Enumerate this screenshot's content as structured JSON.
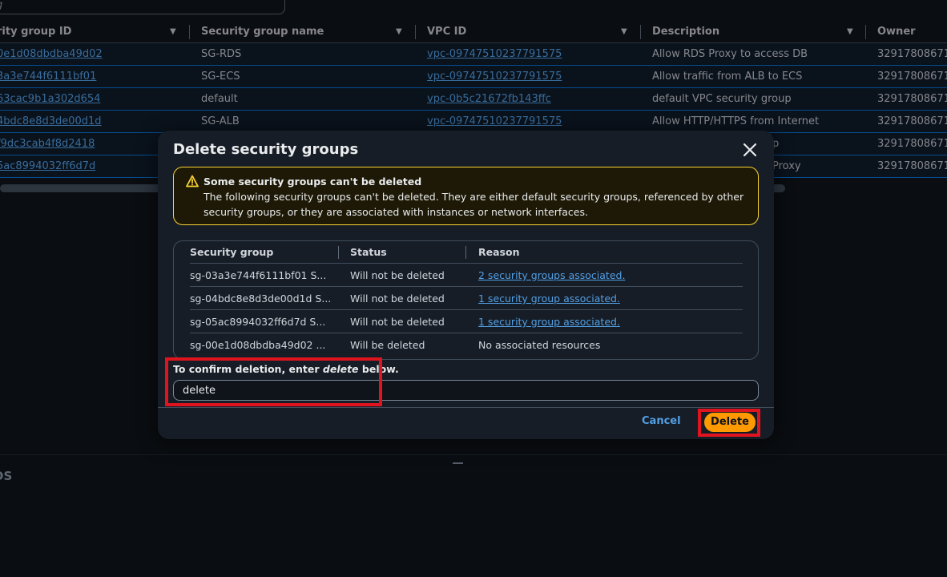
{
  "background": {
    "search_placeholder": "g",
    "columns": [
      "rity group ID",
      "Security group name",
      "VPC ID",
      "Description",
      "Owner"
    ],
    "rows": [
      [
        "0e1d08dbdba49d02",
        "SG-RDS",
        "vpc-09747510237791575",
        "Allow RDS Proxy to access DB",
        "329178086719"
      ],
      [
        "3a3e744f6111bf01",
        "SG-ECS",
        "vpc-09747510237791575",
        "Allow traffic from ALB to ECS",
        "329178086719"
      ],
      [
        "63cac9b1a302d654",
        "default",
        "vpc-0b5c21672fb143ffc",
        "default VPC security group",
        "329178086719"
      ],
      [
        "4bdc8e8d3de00d1d",
        "SG-ALB",
        "vpc-09747510237791575",
        "Allow HTTP/HTTPS from Internet",
        "329178086719"
      ],
      [
        "f9dc3cab4f8d2418",
        "",
        "",
        "p",
        "329178086719"
      ],
      [
        "5ac8994032ff6d7d",
        "",
        "",
        "Proxy",
        "329178086719"
      ]
    ],
    "lower_panel_title": "DS"
  },
  "modal": {
    "title": "Delete security groups",
    "alert_title": "Some security groups can't be deleted",
    "alert_body": "The following security groups can't be deleted. They are either default security groups, referenced by other security groups, or they are associated with instances or network interfaces.",
    "table_headers": [
      "Security group",
      "Status",
      "Reason"
    ],
    "table_rows": [
      {
        "group": "sg-03a3e744f6111bf01 S...",
        "status": "Will not be deleted",
        "reason": "2 security groups associated."
      },
      {
        "group": "sg-04bdc8e8d3de00d1d S...",
        "status": "Will not be deleted",
        "reason": "1 security group associated."
      },
      {
        "group": "sg-05ac8994032ff6d7d S...",
        "status": "Will not be deleted",
        "reason": "1 security group associated."
      },
      {
        "group": "sg-00e1d08dbdba49d02 ...",
        "status": "Will be deleted",
        "reason": "No associated resources"
      }
    ],
    "confirm_prefix": "To confirm deletion, enter ",
    "confirm_keyword": "delete",
    "confirm_suffix": " below.",
    "confirm_value": "delete",
    "cancel_label": "Cancel",
    "delete_label": "Delete"
  },
  "colors": {
    "accent_link": "#539fe5",
    "primary_button": "#ff9900",
    "warning_border": "#fbd332",
    "highlight": "#e0141e"
  }
}
